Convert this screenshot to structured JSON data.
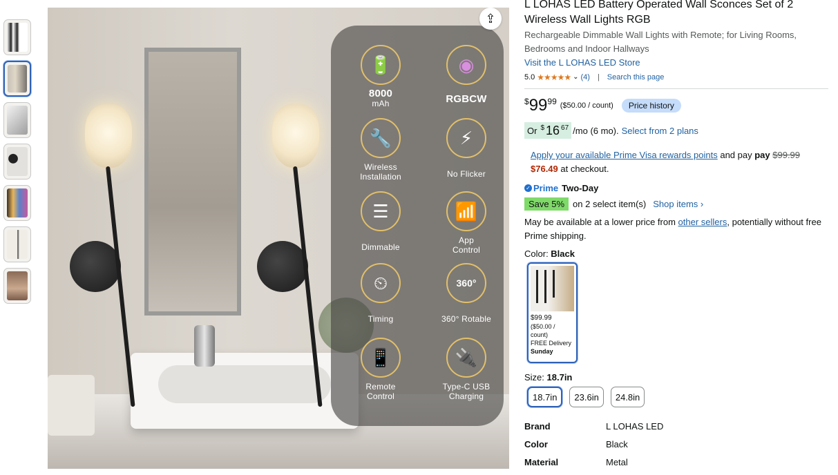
{
  "thumbnails": [
    {
      "color": "#eef0f2"
    },
    {
      "color": "#d7cfc3"
    },
    {
      "color": "#e7e7e7"
    },
    {
      "color": "#d3d0cb"
    },
    {
      "color": "#8c7a66"
    },
    {
      "color": "#e2ddd4"
    },
    {
      "color": "#b79a84"
    }
  ],
  "features": [
    {
      "icon": "battery-icon",
      "glyph": "🔋",
      "value": "8000",
      "label": "mAh"
    },
    {
      "icon": "rgb-color-icon",
      "glyph": "◉",
      "value": "RGBCW",
      "label": ""
    },
    {
      "icon": "wrench-icon",
      "glyph": "🔧",
      "value": "",
      "label": "Wireless Installation"
    },
    {
      "icon": "no-flicker-icon",
      "glyph": "⚡",
      "value": "",
      "label": "No Flicker"
    },
    {
      "icon": "dimmer-slider-icon",
      "glyph": "☰",
      "value": "",
      "label": "Dimmable"
    },
    {
      "icon": "wifi-phone-icon",
      "glyph": "📶",
      "value": "",
      "label": "App Control"
    },
    {
      "icon": "timer-icon",
      "glyph": "⏲",
      "value": "",
      "label": "Timing"
    },
    {
      "icon": "rotate-360-icon",
      "glyph": "360°",
      "value": "",
      "label": "360° Rotable"
    },
    {
      "icon": "remote-icon",
      "glyph": "📱",
      "value": "",
      "label": "Remote Control"
    },
    {
      "icon": "usb-c-icon",
      "glyph": "🔌",
      "value": "",
      "label": "Type-C USB Charging"
    }
  ],
  "product": {
    "title": "L LOHAS LED Battery Operated Wall Sconces Set of 2 Wireless Wall Lights RGB",
    "subtitle": "Rechargeable Dimmable Wall Lights with Remote; for Living Rooms, Bedrooms and Indoor Hallways",
    "store_link": "Visit the L LOHAS LED Store",
    "rating": "5.0",
    "stars": "★★★★★",
    "review_count": "(4)",
    "separator": "|",
    "search_page": "Search this page"
  },
  "price": {
    "symbol": "$",
    "whole": "99",
    "fraction": "99",
    "per_count": "($50.00 / count)",
    "history_button": "Price history"
  },
  "installments": {
    "or": "Or",
    "symbol": "$",
    "amount": "16",
    "fraction": "67",
    "term": "/mo (6 mo).",
    "plans_link": "Select from 2 plans"
  },
  "visa": {
    "link": "Apply your available Prime Visa rewards points",
    "and_pay": " and pay ",
    "original": "$99.99",
    "discounted": "$76.49",
    "at_checkout": " at checkout."
  },
  "prime": {
    "check": "✓",
    "logo": "Prime",
    "delivery": "Two-Day"
  },
  "save": {
    "badge": "Save 5%",
    "text": "on 2 select item(s)",
    "shop_link": "Shop items ›"
  },
  "lower_price": {
    "prefix": "May be available at a lower price from ",
    "link": "other sellers",
    "suffix": ", potentially without free Prime shipping."
  },
  "color": {
    "label": "Color: ",
    "selected": "Black",
    "option_price": "$99.99",
    "option_per_count": "($50.00 / count)",
    "option_delivery": "FREE Delivery",
    "option_day": "Sunday"
  },
  "size": {
    "label": "Size: ",
    "selected": "18.7in",
    "options": [
      "18.7in",
      "23.6in",
      "24.8in"
    ]
  },
  "specs": [
    {
      "key": "Brand",
      "value": "L LOHAS LED"
    },
    {
      "key": "Color",
      "value": "Black"
    },
    {
      "key": "Material",
      "value": "Metal"
    }
  ],
  "share_icon": "⇪"
}
